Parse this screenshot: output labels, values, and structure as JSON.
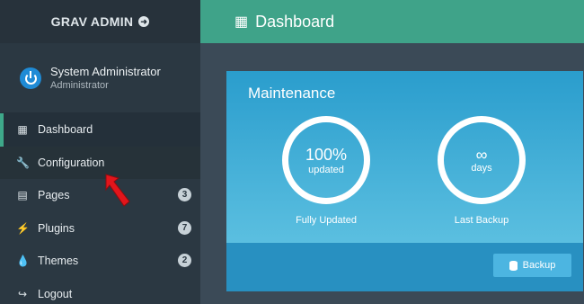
{
  "brand": {
    "title": "GRAV ADMIN"
  },
  "user": {
    "name": "System Administrator",
    "role": "Administrator"
  },
  "nav": [
    {
      "label": "Dashboard",
      "icon": "grid-icon",
      "state": "active"
    },
    {
      "label": "Configuration",
      "icon": "wrench-icon",
      "state": "hover"
    },
    {
      "label": "Pages",
      "icon": "file-icon",
      "badge": "3"
    },
    {
      "label": "Plugins",
      "icon": "plug-icon",
      "badge": "7"
    },
    {
      "label": "Themes",
      "icon": "tint-icon",
      "badge": "2"
    },
    {
      "label": "Logout",
      "icon": "sign-out-icon"
    }
  ],
  "header": {
    "title": "Dashboard",
    "icon": "grid-icon"
  },
  "maintenance": {
    "title": "Maintenance",
    "updates": {
      "value": "100%",
      "sub": "updated",
      "label": "Fully Updated"
    },
    "backup": {
      "value": "∞",
      "sub": "days",
      "label": "Last Backup"
    },
    "backup_button": "Backup"
  },
  "colors": {
    "sidebar": "#2b3842",
    "header": "#3fa389",
    "card": "#2a9dcd",
    "annotation": "#e2151b"
  }
}
